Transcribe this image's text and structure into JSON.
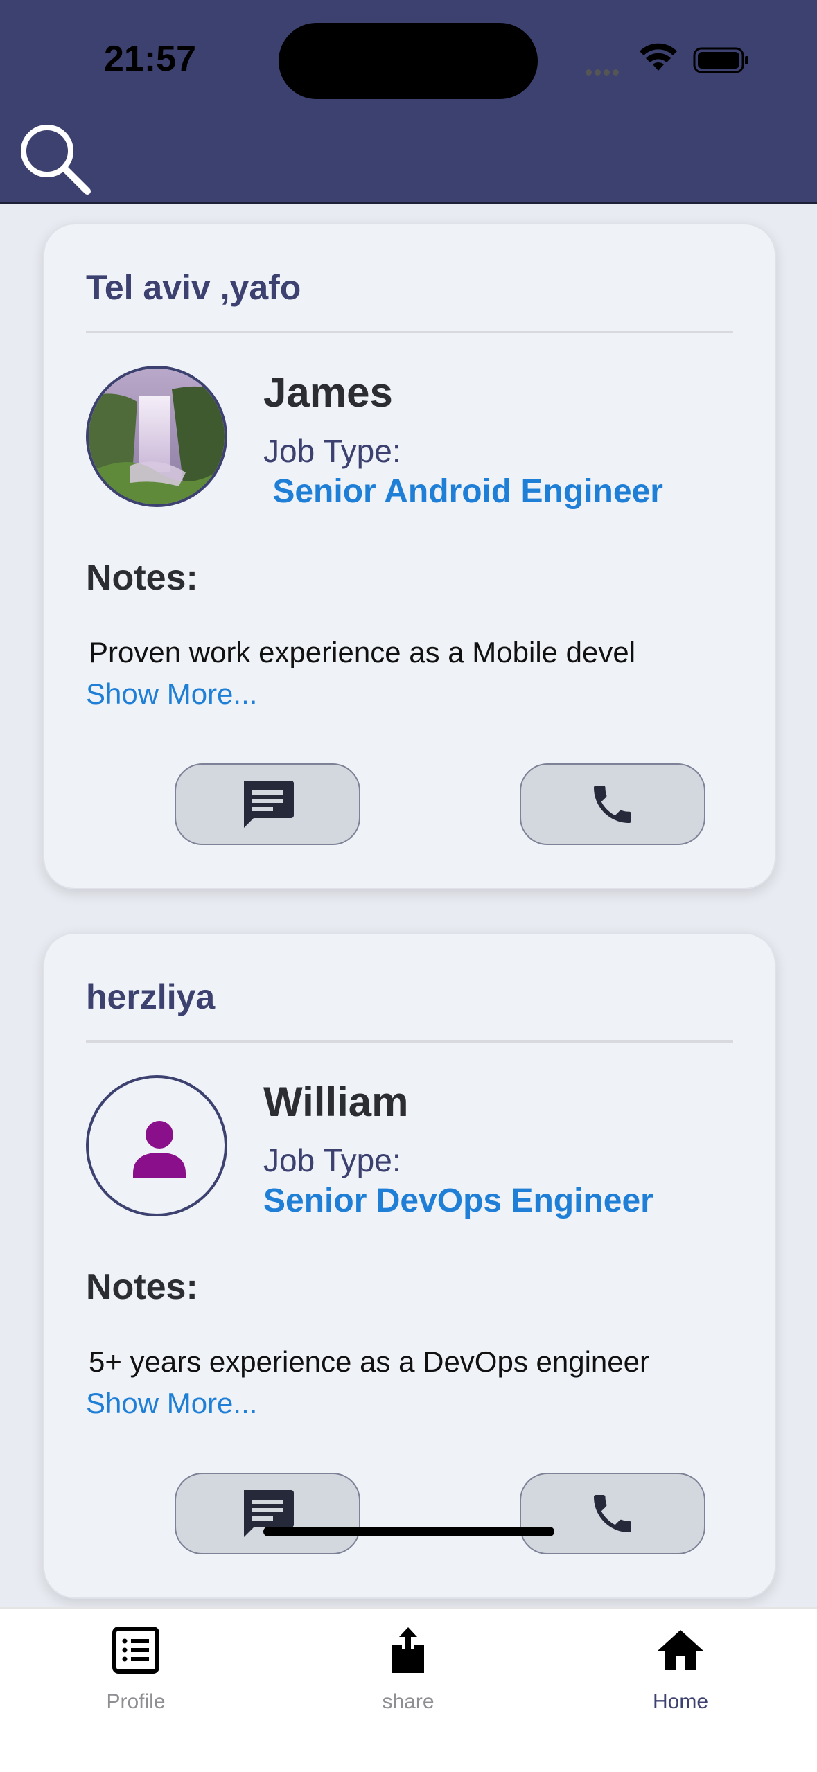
{
  "status_bar": {
    "time": "21:57"
  },
  "cards": [
    {
      "city": "Tel aviv ,yafo",
      "name": "James",
      "job_label": "Job Type:",
      "job_value": " Senior Android Engineer",
      "notes_label": "Notes:",
      "notes_text": "Proven work experience as a Mobile devel",
      "show_more": "Show More..."
    },
    {
      "city": "herzliya",
      "name": "William",
      "job_label": "Job Type:",
      "job_value": "Senior DevOps Engineer",
      "notes_label": "Notes:",
      "notes_text": "5+ years experience as a DevOps engineer",
      "show_more": "Show More..."
    }
  ],
  "tab_bar": {
    "profile": "Profile",
    "share": "share",
    "home": "Home",
    "active": "home"
  },
  "colors": {
    "header": "#3c4170",
    "accent_link": "#1f7fd6",
    "avatar_person": "#8a0f8a"
  }
}
